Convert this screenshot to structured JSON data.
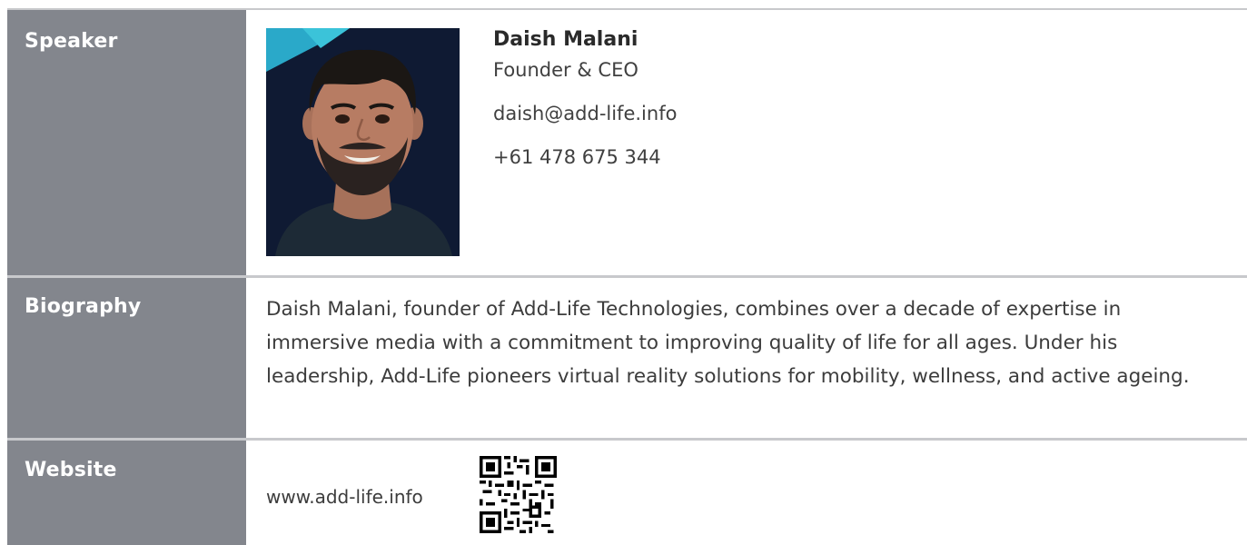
{
  "speaker": {
    "label": "Speaker",
    "name": "Daish Malani",
    "title": "Founder & CEO",
    "email": "daish@add-life.info",
    "phone": "+61 478 675 344"
  },
  "biography": {
    "label": "Biography",
    "text": "Daish Malani, founder of Add-Life Technologies, combines over a decade of expertise in immersive media with a commitment to improving quality of life for all ages. Under his leadership, Add-Life pioneers virtual reality solutions for mobility, wellness, and active ageing."
  },
  "website": {
    "label": "Website",
    "url": "www.add-life.info"
  },
  "colors": {
    "label_bg": "#83868d",
    "divider": "#c8c9cc",
    "photo_bg": "#0f1a33",
    "photo_accent": "#2aa9c9"
  }
}
